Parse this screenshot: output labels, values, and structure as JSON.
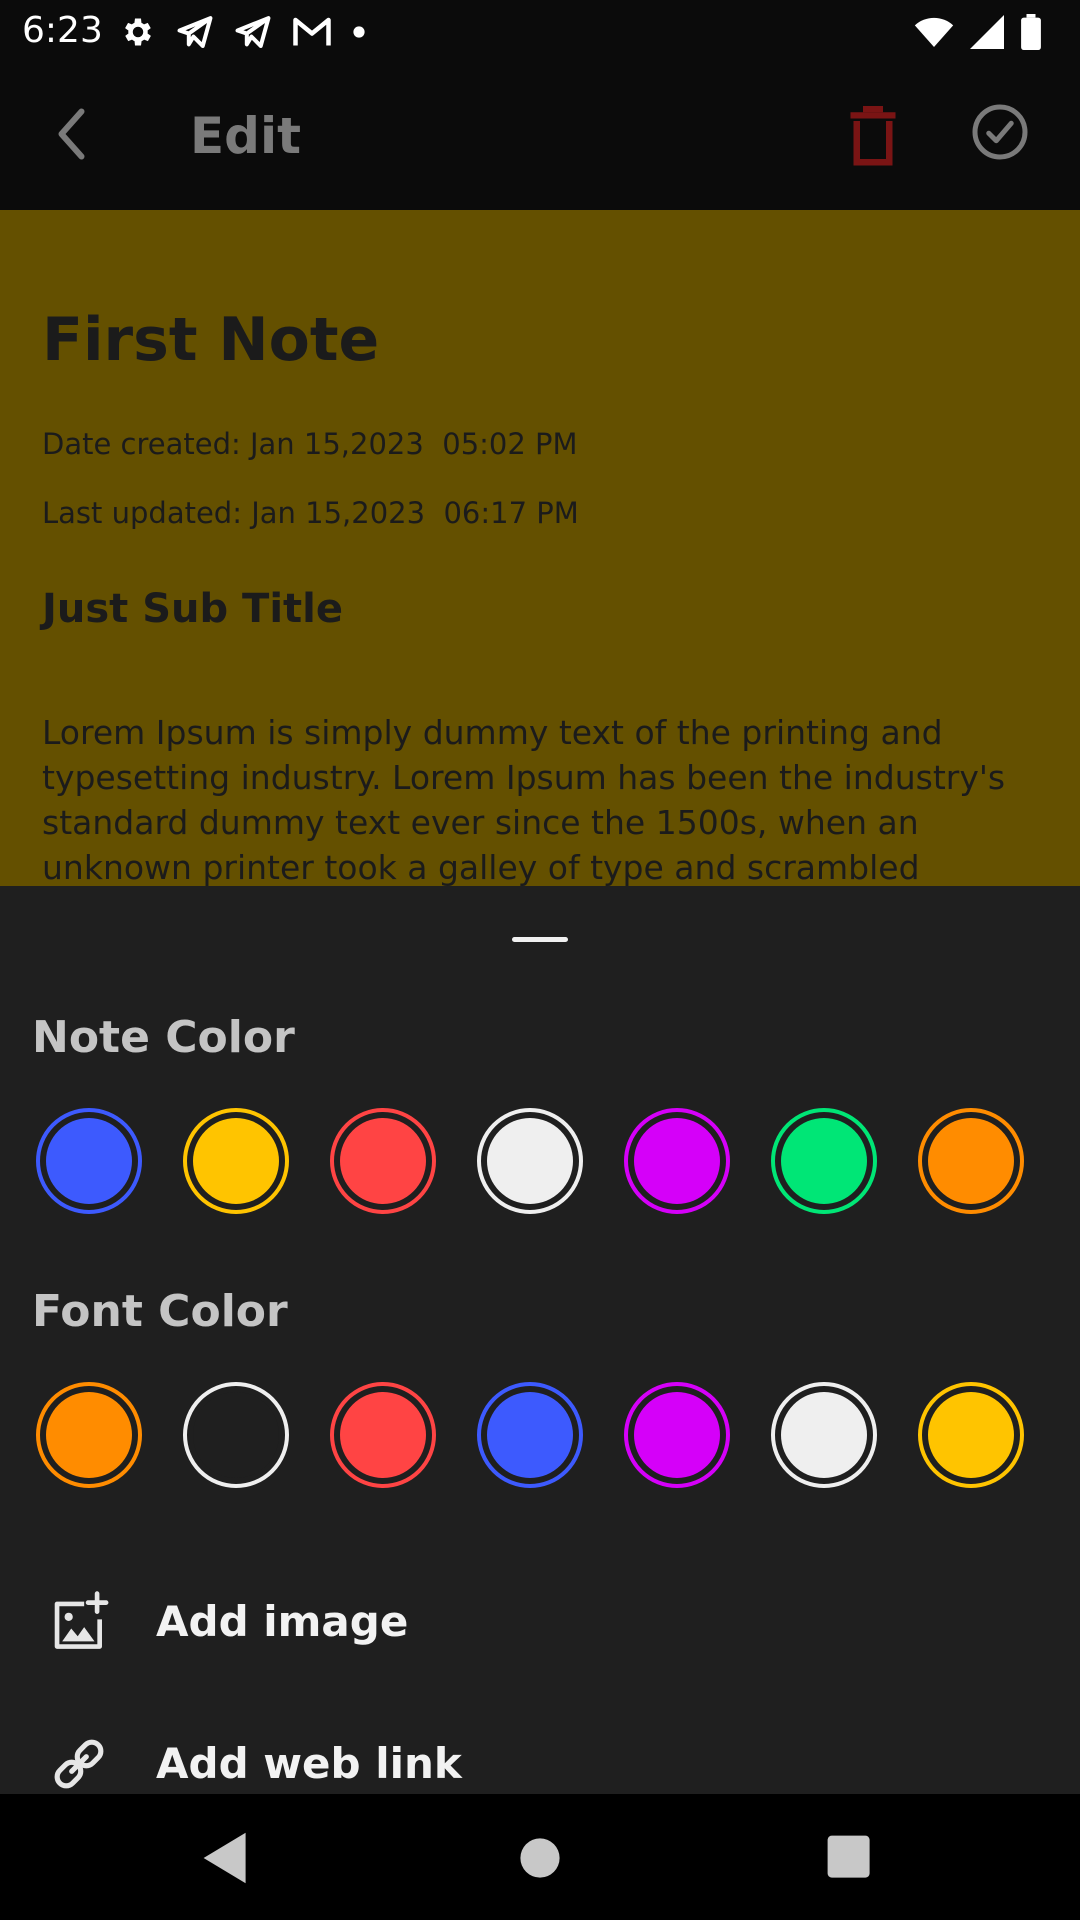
{
  "status_bar": {
    "time": "6:23",
    "left_icons": [
      "gear-icon",
      "telegram-icon",
      "telegram-icon",
      "gmail-icon",
      "dot-icon"
    ],
    "right_icons": [
      "wifi-icon",
      "signal-icon",
      "battery-icon"
    ]
  },
  "app_bar": {
    "title": "Edit",
    "back_icon": "arrow-back-icon",
    "delete_icon": "trash-icon",
    "done_icon": "check-circle-icon",
    "delete_color": "#7a1414",
    "icon_color": "#7a7a7a"
  },
  "note": {
    "background": "#645000",
    "title": "First Note",
    "date_created": "Date created: Jan 15,2023  05:02 PM",
    "last_updated": "Last updated: Jan 15,2023  06:17 PM",
    "subtitle": "Just Sub Title",
    "body": "Lorem Ipsum is simply dummy text of the printing and typesetting industry. Lorem Ipsum has been the industry's standard dummy text ever since the 1500s, when an unknown printer took a galley of type and scrambled"
  },
  "sheet": {
    "note_color_label": "Note Color",
    "font_color_label": "Font Color",
    "note_colors": [
      {
        "name": "blue",
        "fill": "#3d5afe",
        "ring": "#3d5afe"
      },
      {
        "name": "yellow",
        "fill": "#ffc400",
        "ring": "#ffc400"
      },
      {
        "name": "red",
        "fill": "#ff4444",
        "ring": "#ff4444"
      },
      {
        "name": "white",
        "fill": "#efefef",
        "ring": "#efefef"
      },
      {
        "name": "purple",
        "fill": "#d500f9",
        "ring": "#d500f9"
      },
      {
        "name": "green",
        "fill": "#00e676",
        "ring": "#00e676"
      },
      {
        "name": "orange",
        "fill": "#ff8c00",
        "ring": "#ff8c00"
      }
    ],
    "font_colors": [
      {
        "name": "orange",
        "fill": "#ff8c00",
        "ring": "#ff8c00"
      },
      {
        "name": "black",
        "fill": "#1f1f1f",
        "ring": "#efefef"
      },
      {
        "name": "red",
        "fill": "#ff4444",
        "ring": "#ff4444"
      },
      {
        "name": "blue",
        "fill": "#3d5afe",
        "ring": "#3d5afe"
      },
      {
        "name": "purple",
        "fill": "#d500f9",
        "ring": "#d500f9"
      },
      {
        "name": "white",
        "fill": "#efefef",
        "ring": "#efefef"
      },
      {
        "name": "yellow",
        "fill": "#ffc400",
        "ring": "#ffc400"
      }
    ],
    "add_image_label": "Add image",
    "add_image_icon": "add-image-icon",
    "add_link_label": "Add web link",
    "add_link_icon": "link-icon"
  },
  "nav_bar": {
    "icons": [
      "nav-back-icon",
      "nav-home-icon",
      "nav-recents-icon"
    ]
  }
}
